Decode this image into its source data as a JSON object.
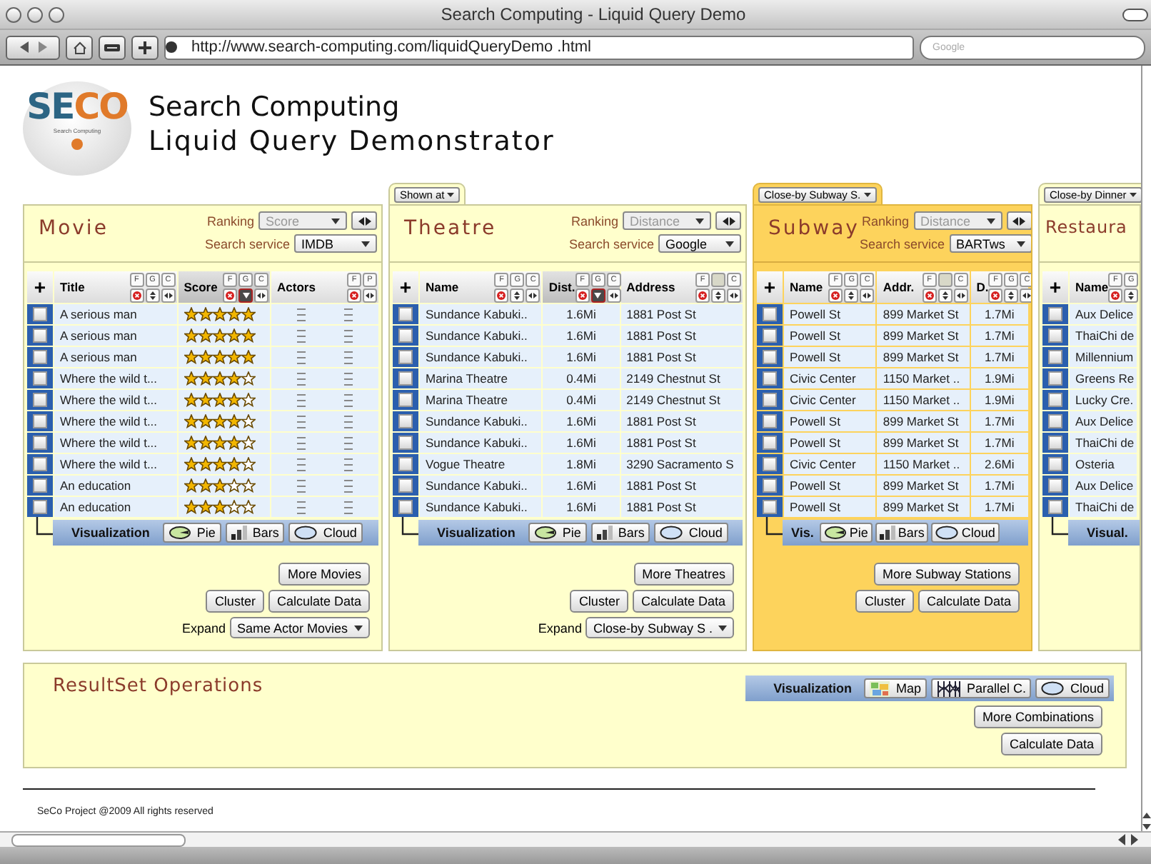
{
  "window": {
    "title": "Search Computing - Liquid Query Demo"
  },
  "toolbar": {
    "url": "http://www.search-computing.com/liquidQueryDemo .html",
    "search_placeholder": "Google"
  },
  "logo": {
    "parts": [
      "SE",
      "CO"
    ],
    "tagline": "Search Computing"
  },
  "headline": [
    "Search Computing",
    "Liquid Query Demonstrator"
  ],
  "panels": [
    {
      "title": "Movie",
      "highlighted": false,
      "ranking": {
        "label": "Ranking",
        "placeholder": "Score"
      },
      "service": {
        "label": "Search service",
        "value": "IMDB"
      },
      "add": "+",
      "columns": [
        {
          "label": "Title",
          "kind": "text",
          "tools": [
            {
              "label": "F"
            },
            {
              "label": "G"
            },
            {
              "label": "C"
            }
          ],
          "sortable": true,
          "sorted": false
        },
        {
          "label": "Score",
          "kind": "stars",
          "tools": [
            {
              "label": "F"
            },
            {
              "label": "G"
            },
            {
              "label": "C"
            }
          ],
          "sortable": true,
          "sorted": true
        },
        {
          "label": "Actors",
          "kind": "lines",
          "tools": [
            {
              "label": "F"
            },
            {
              "label": "P"
            }
          ],
          "sortable": false,
          "sorted": false
        }
      ],
      "rows": [
        {
          "checked": false,
          "cells": [
            {
              "text": "A serious man"
            },
            {
              "stars": 5
            }
          ]
        },
        {
          "checked": false,
          "cells": [
            {
              "text": "A serious man"
            },
            {
              "stars": 5
            }
          ]
        },
        {
          "checked": false,
          "cells": [
            {
              "text": "A serious man"
            },
            {
              "stars": 5
            }
          ]
        },
        {
          "checked": false,
          "cells": [
            {
              "text": "Where the wild t..."
            },
            {
              "stars": 4
            }
          ]
        },
        {
          "checked": false,
          "cells": [
            {
              "text": "Where the wild t..."
            },
            {
              "stars": 4
            }
          ]
        },
        {
          "checked": false,
          "cells": [
            {
              "text": "Where the wild t..."
            },
            {
              "stars": 4
            }
          ]
        },
        {
          "checked": false,
          "cells": [
            {
              "text": "Where the wild t..."
            },
            {
              "stars": 4
            }
          ]
        },
        {
          "checked": false,
          "cells": [
            {
              "text": "Where the wild t..."
            },
            {
              "stars": 4
            }
          ]
        },
        {
          "checked": false,
          "cells": [
            {
              "text": "An education"
            },
            {
              "stars": 3
            }
          ]
        },
        {
          "checked": false,
          "cells": [
            {
              "text": "An education"
            },
            {
              "stars": 3
            }
          ]
        }
      ],
      "visualization": {
        "label": "Visualization",
        "buttons": [
          {
            "kind": "pie",
            "label": "Pie"
          },
          {
            "kind": "bars",
            "label": "Bars"
          },
          {
            "kind": "cloud",
            "label": "Cloud"
          }
        ]
      },
      "actions": [
        [
          "More Movies"
        ],
        [
          "Cluster",
          "Calculate Data"
        ]
      ],
      "expand": {
        "label": "Expand",
        "value": "Same Actor Movies"
      }
    },
    {
      "tab": "Shown at",
      "title": "Theatre",
      "highlighted": false,
      "ranking": {
        "label": "Ranking",
        "placeholder": "Distance"
      },
      "service": {
        "label": "Search service",
        "value": "Google"
      },
      "add": "+",
      "columns": [
        {
          "label": "Name",
          "kind": "text",
          "tools": [
            {
              "label": "F"
            },
            {
              "label": "G"
            },
            {
              "label": "C"
            }
          ],
          "sortable": true,
          "sorted": false
        },
        {
          "label": "Dist.",
          "kind": "number",
          "tools": [
            {
              "label": "F"
            },
            {
              "label": "G"
            },
            {
              "label": "C"
            }
          ],
          "sortable": true,
          "sorted": true
        },
        {
          "label": "Address",
          "kind": "text",
          "tools": [
            {
              "label": "F"
            },
            {
              "disabled": true
            },
            {
              "label": "C"
            }
          ],
          "sortable": true,
          "sorted": false
        }
      ],
      "rows": [
        {
          "checked": false,
          "cells": [
            {
              "text": "Sundance Kabuki.."
            },
            {
              "text": "1.6Mi"
            },
            {
              "text": "1881 Post St"
            }
          ]
        },
        {
          "checked": false,
          "cells": [
            {
              "text": "Sundance Kabuki.."
            },
            {
              "text": "1.6Mi"
            },
            {
              "text": "1881 Post St"
            }
          ]
        },
        {
          "checked": false,
          "cells": [
            {
              "text": "Sundance Kabuki.."
            },
            {
              "text": "1.6Mi"
            },
            {
              "text": "1881 Post St"
            }
          ]
        },
        {
          "checked": false,
          "cells": [
            {
              "text": "Marina Theatre"
            },
            {
              "text": "0.4Mi"
            },
            {
              "text": "2149 Chestnut St"
            }
          ]
        },
        {
          "checked": false,
          "cells": [
            {
              "text": "Marina Theatre"
            },
            {
              "text": "0.4Mi"
            },
            {
              "text": "2149 Chestnut St"
            }
          ]
        },
        {
          "checked": false,
          "cells": [
            {
              "text": "Sundance Kabuki.."
            },
            {
              "text": "1.6Mi"
            },
            {
              "text": "1881 Post St"
            }
          ]
        },
        {
          "checked": false,
          "cells": [
            {
              "text": "Sundance Kabuki.."
            },
            {
              "text": "1.6Mi"
            },
            {
              "text": "1881 Post St"
            }
          ]
        },
        {
          "checked": false,
          "cells": [
            {
              "text": "Vogue Theatre"
            },
            {
              "text": "1.8Mi"
            },
            {
              "text": "3290 Sacramento S"
            }
          ]
        },
        {
          "checked": false,
          "cells": [
            {
              "text": "Sundance Kabuki.."
            },
            {
              "text": "1.6Mi"
            },
            {
              "text": "1881 Post St"
            }
          ]
        },
        {
          "checked": false,
          "cells": [
            {
              "text": "Sundance Kabuki.."
            },
            {
              "text": "1.6Mi"
            },
            {
              "text": "1881 Post St"
            }
          ]
        }
      ],
      "visualization": {
        "label": "Visualization",
        "buttons": [
          {
            "kind": "pie",
            "label": "Pie"
          },
          {
            "kind": "bars",
            "label": "Bars"
          },
          {
            "kind": "cloud",
            "label": "Cloud"
          }
        ]
      },
      "actions": [
        [
          "More Theatres"
        ],
        [
          "Cluster",
          "Calculate Data"
        ]
      ],
      "expand": {
        "label": "Expand",
        "value": "Close-by Subway S ."
      }
    },
    {
      "tab": "Close-by Subway S.",
      "title": "Subway",
      "highlighted": true,
      "ranking": {
        "label": "Ranking",
        "placeholder": "Distance"
      },
      "service": {
        "label": "Search service",
        "value": "BARTws"
      },
      "add": "+",
      "columns": [
        {
          "label": "Name",
          "kind": "text",
          "tools": [
            {
              "label": "F"
            },
            {
              "label": "G"
            },
            {
              "label": "C"
            }
          ],
          "sortable": true,
          "sorted": false
        },
        {
          "label": "Addr.",
          "kind": "text",
          "tools": [
            {
              "label": "F"
            },
            {
              "disabled": true
            },
            {
              "label": "C"
            }
          ],
          "sortable": true,
          "sorted": false
        },
        {
          "label": "D.",
          "kind": "number",
          "tools": [
            {
              "label": "F"
            },
            {
              "label": "G"
            },
            {
              "label": "C"
            }
          ],
          "sortable": true,
          "sorted": false
        }
      ],
      "rows": [
        {
          "checked": false,
          "cells": [
            {
              "text": "Powell St"
            },
            {
              "text": "899 Market St"
            },
            {
              "text": "1.7Mi"
            }
          ]
        },
        {
          "checked": false,
          "cells": [
            {
              "text": "Powell St"
            },
            {
              "text": "899 Market St"
            },
            {
              "text": "1.7Mi"
            }
          ]
        },
        {
          "checked": false,
          "cells": [
            {
              "text": "Powell St"
            },
            {
              "text": "899 Market St"
            },
            {
              "text": "1.7Mi"
            }
          ]
        },
        {
          "checked": false,
          "cells": [
            {
              "text": "Civic Center"
            },
            {
              "text": "1150 Market .."
            },
            {
              "text": "1.9Mi"
            }
          ]
        },
        {
          "checked": false,
          "cells": [
            {
              "text": "Civic Center"
            },
            {
              "text": "1150 Market .."
            },
            {
              "text": "1.9Mi"
            }
          ]
        },
        {
          "checked": false,
          "cells": [
            {
              "text": "Powell St"
            },
            {
              "text": "899 Market St"
            },
            {
              "text": "1.7Mi"
            }
          ]
        },
        {
          "checked": false,
          "cells": [
            {
              "text": "Powell St"
            },
            {
              "text": "899 Market St"
            },
            {
              "text": "1.7Mi"
            }
          ]
        },
        {
          "checked": false,
          "cells": [
            {
              "text": "Civic Center"
            },
            {
              "text": "1150 Market .."
            },
            {
              "text": "2.6Mi"
            }
          ]
        },
        {
          "checked": false,
          "cells": [
            {
              "text": "Powell St"
            },
            {
              "text": "899 Market St"
            },
            {
              "text": "1.7Mi"
            }
          ]
        },
        {
          "checked": false,
          "cells": [
            {
              "text": "Powell St"
            },
            {
              "text": "899 Market St"
            },
            {
              "text": "1.7Mi"
            }
          ]
        }
      ],
      "visualization": {
        "label": "Vis.",
        "buttons": [
          {
            "kind": "pie",
            "label": "Pie"
          },
          {
            "kind": "bars",
            "label": "Bars"
          },
          {
            "kind": "cloud",
            "label": "Cloud"
          }
        ]
      },
      "actions": [
        [
          "More Subway Stations"
        ],
        [
          "Cluster",
          "Calculate Data"
        ]
      ]
    },
    {
      "tab": "Close-by Dinner",
      "title": "Restaura",
      "highlighted": false,
      "add": "+",
      "columns": [
        {
          "label": "Name",
          "kind": "text",
          "tools": [
            {
              "label": "F"
            },
            {
              "label": "G"
            }
          ],
          "sortable": true,
          "sorted": false
        }
      ],
      "rows": [
        {
          "checked": false,
          "cells": [
            {
              "text": "Aux Delice"
            }
          ]
        },
        {
          "checked": false,
          "cells": [
            {
              "text": "ThaiChi de"
            }
          ]
        },
        {
          "checked": false,
          "cells": [
            {
              "text": "Millennium"
            }
          ]
        },
        {
          "checked": false,
          "cells": [
            {
              "text": "Greens Re"
            }
          ]
        },
        {
          "checked": false,
          "cells": [
            {
              "text": "Lucky Cre."
            }
          ]
        },
        {
          "checked": false,
          "cells": [
            {
              "text": "Aux Delice"
            }
          ]
        },
        {
          "checked": false,
          "cells": [
            {
              "text": "ThaiChi de"
            }
          ]
        },
        {
          "checked": false,
          "cells": [
            {
              "text": "Osteria"
            }
          ]
        },
        {
          "checked": false,
          "cells": [
            {
              "text": "Aux Delice"
            }
          ]
        },
        {
          "checked": false,
          "cells": [
            {
              "text": "ThaiChi de"
            }
          ]
        }
      ],
      "visualization": {
        "label": "Visual."
      }
    }
  ],
  "resultset": {
    "title": "ResultSet Operations",
    "visualization": {
      "label": "Visualization",
      "buttons": [
        {
          "kind": "map",
          "label": "Map"
        },
        {
          "kind": "parallel",
          "label": "Parallel C."
        },
        {
          "kind": "cloud",
          "label": "Cloud"
        }
      ]
    },
    "actions": [
      "More Combinations",
      "Calculate Data"
    ]
  },
  "footer": "SeCo Project @2009 All rights reserved"
}
